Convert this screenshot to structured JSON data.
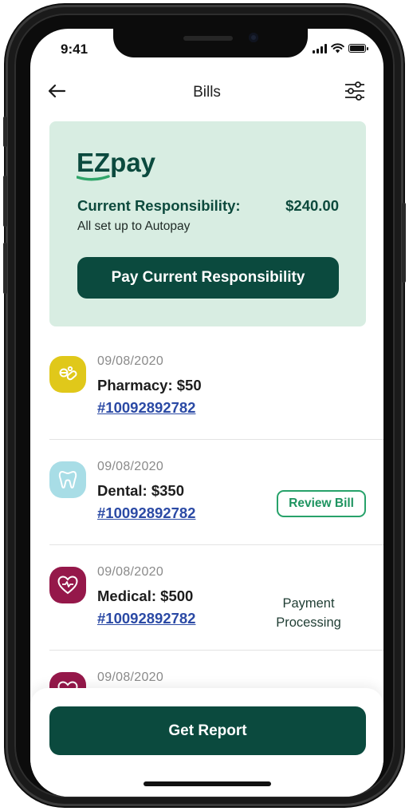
{
  "status_bar": {
    "time": "9:41"
  },
  "header": {
    "title": "Bills"
  },
  "ezpay": {
    "logo_text": "EZpay",
    "responsibility_label": "Current Responsibility:",
    "responsibility_amount": "$240.00",
    "autopay_text": "All set up to Autopay",
    "pay_button_label": "Pay Current Responsibility"
  },
  "bills": [
    {
      "date": "09/08/2020",
      "title": "Pharmacy: $50",
      "link": "#10092892782",
      "icon": "pill-icon",
      "icon_color": "#e0c81a"
    },
    {
      "date": "09/08/2020",
      "title": "Dental: $350",
      "link": "#10092892782",
      "icon": "tooth-icon",
      "icon_color": "#a8dde6",
      "action_label": "Review Bill"
    },
    {
      "date": "09/08/2020",
      "title": "Medical: $500",
      "link": "#10092892782",
      "icon": "heart-pulse-icon",
      "icon_color": "#95184a",
      "status_line1": "Payment",
      "status_line2": "Processing"
    },
    {
      "date": "09/08/2020",
      "icon": "heart-icon",
      "icon_color": "#95184a"
    }
  ],
  "footer": {
    "report_button_label": "Get Report"
  },
  "colors": {
    "brand_dark": "#0b4a3e",
    "brand_green": "#27a26a",
    "card_bg": "#d8ede2",
    "link_blue": "#2b4aa5"
  }
}
